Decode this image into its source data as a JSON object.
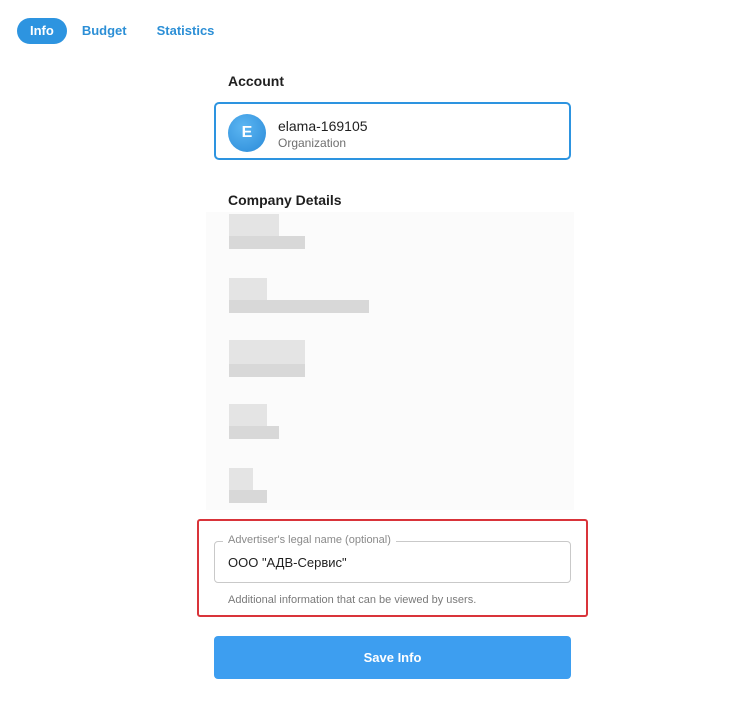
{
  "tabs": [
    {
      "label": "Info",
      "active": true
    },
    {
      "label": "Budget",
      "active": false
    },
    {
      "label": "Statistics",
      "active": false
    }
  ],
  "account": {
    "section_title": "Account",
    "avatar_letter": "E",
    "name": "elama-169105",
    "type": "Organization"
  },
  "company": {
    "section_title": "Company Details"
  },
  "legal_name": {
    "label": "Advertiser's legal name (optional)",
    "value": "ООО \"АДВ-Сервис\"",
    "helper": "Additional information that can be viewed by users."
  },
  "save_button": {
    "label": "Save Info"
  },
  "colors": {
    "accent": "#2d94e0",
    "button": "#3d9ef0",
    "highlight": "#d9343a"
  }
}
